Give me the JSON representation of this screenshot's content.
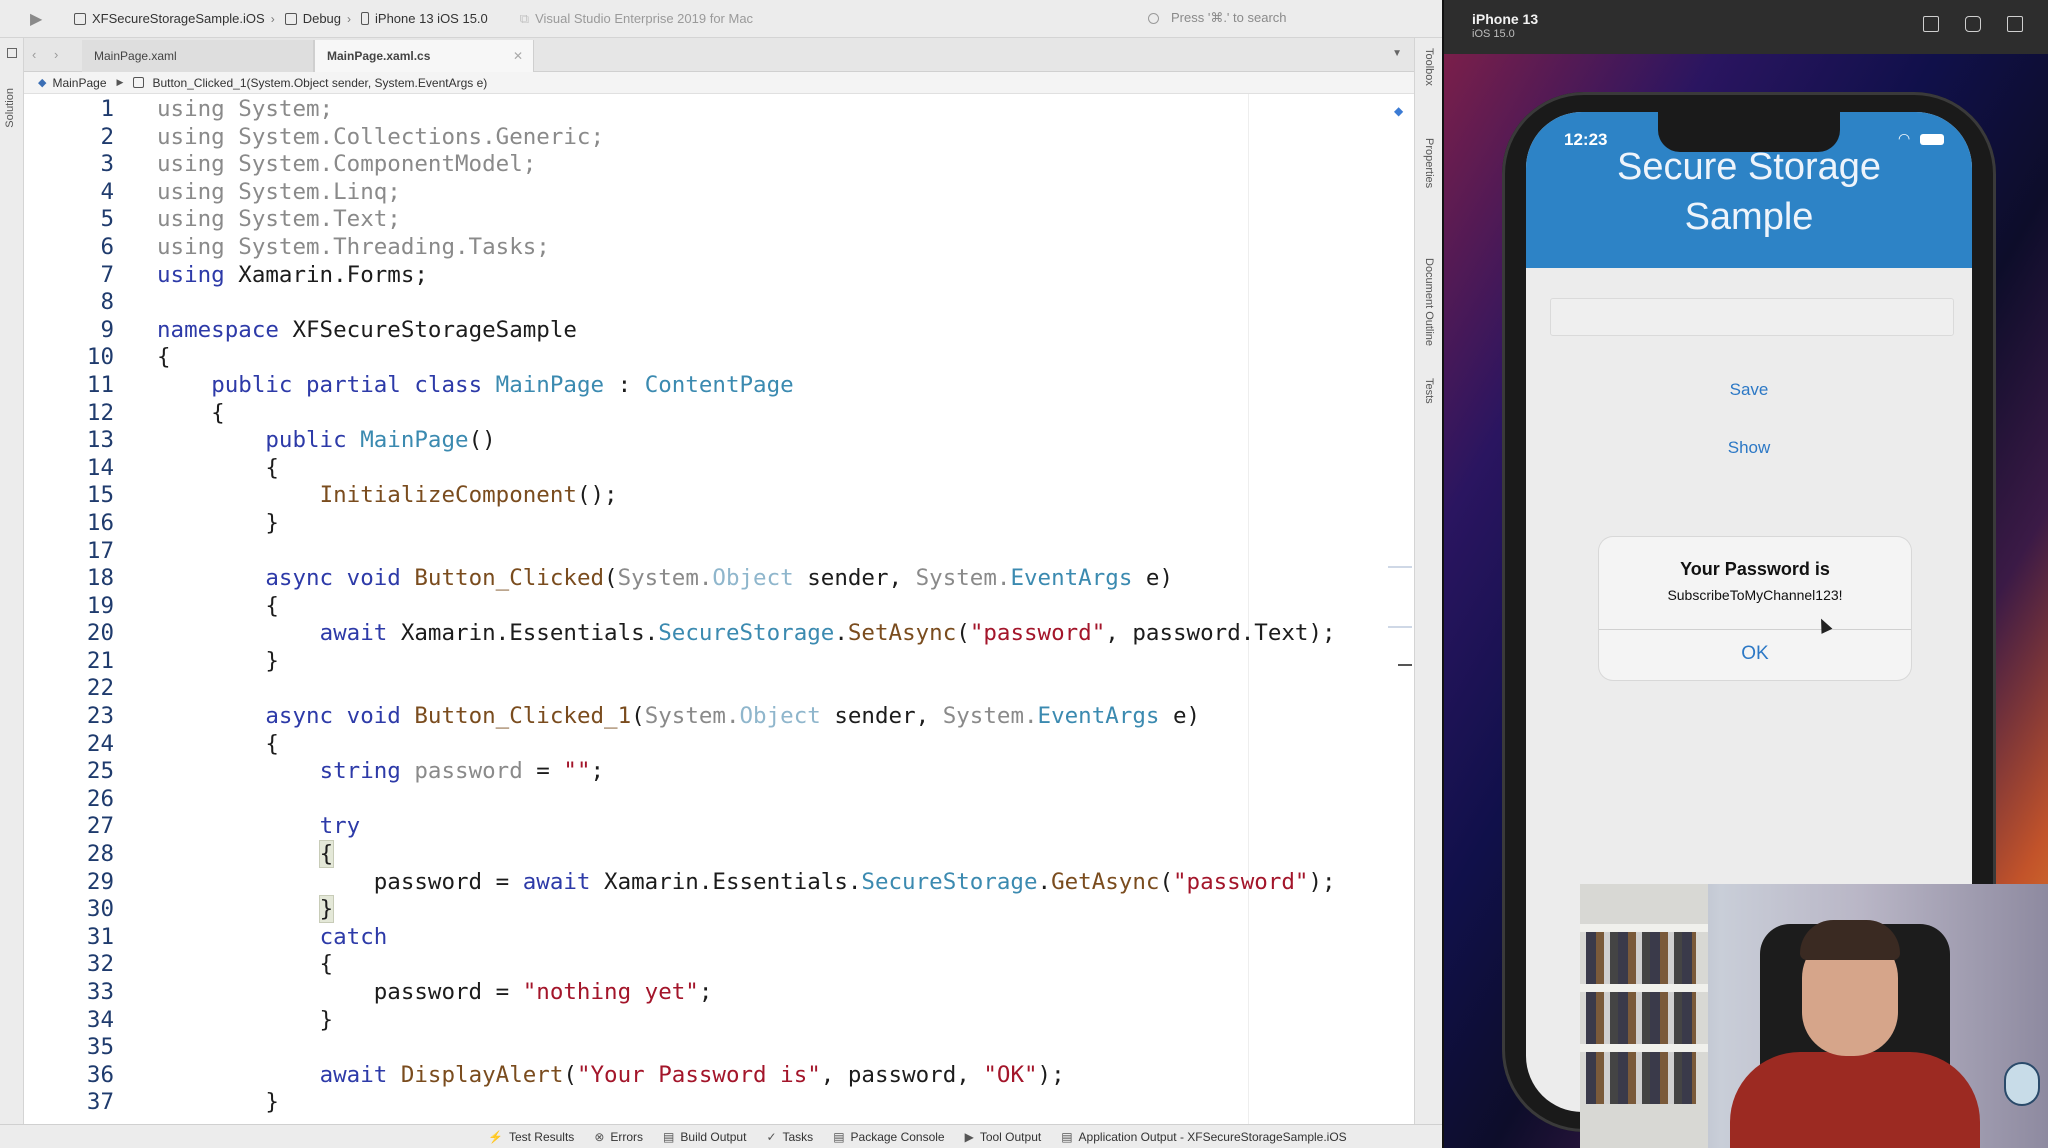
{
  "toolbar": {
    "project": "XFSecureStorageSample.iOS",
    "config": "Debug",
    "device": "iPhone 13 iOS 15.0",
    "app_name": "Visual Studio Enterprise 2019 for Mac",
    "search_placeholder": "Press '⌘.' to search"
  },
  "left_strip": {
    "label": "Solution"
  },
  "right_strip": {
    "labels": [
      "Toolbox",
      "Properties",
      "Document Outline",
      "Tests"
    ]
  },
  "tabs": [
    {
      "label": "MainPage.xaml",
      "active": false
    },
    {
      "label": "MainPage.xaml.cs",
      "active": true
    }
  ],
  "breadcrumb": {
    "class": "MainPage",
    "member": "Button_Clicked_1(System.Object sender, System.EventArgs e)"
  },
  "code_lines": [
    "1",
    "2",
    "3",
    "4",
    "5",
    "6",
    "7",
    "8",
    "9",
    "10",
    "11",
    "12",
    "13",
    "14",
    "15",
    "16",
    "17",
    "18",
    "19",
    "20",
    "21",
    "22",
    "23",
    "24",
    "25",
    "26",
    "27",
    "28",
    "29",
    "30",
    "31",
    "32",
    "33",
    "34",
    "35",
    "36",
    "37"
  ],
  "status_bar": [
    {
      "icon": "wrench-icon",
      "label": "Test Results"
    },
    {
      "icon": "error-icon",
      "label": "Errors"
    },
    {
      "icon": "output-icon",
      "label": "Build Output"
    },
    {
      "icon": "check-icon",
      "label": "Tasks"
    },
    {
      "icon": "package-icon",
      "label": "Package Console"
    },
    {
      "icon": "play-icon",
      "label": "Tool Output"
    },
    {
      "icon": "output-icon",
      "label": "Application Output - XFSecureStorageSample.iOS"
    }
  ],
  "simulator": {
    "device_name": "iPhone 13",
    "os_version": "iOS 15.0",
    "time": "12:23",
    "app_title": "Secure Storage Sample",
    "buttons": {
      "save": "Save",
      "show": "Show"
    },
    "alert": {
      "title": "Your Password is",
      "message": "SubscribeToMyChannel123!",
      "ok": "OK"
    }
  },
  "colors": {
    "nav_header": "#2d83c6",
    "button_text": "#2c78c5",
    "keyword": "#2d3aa8",
    "type": "#3b8ab0",
    "string": "#a3152a"
  }
}
